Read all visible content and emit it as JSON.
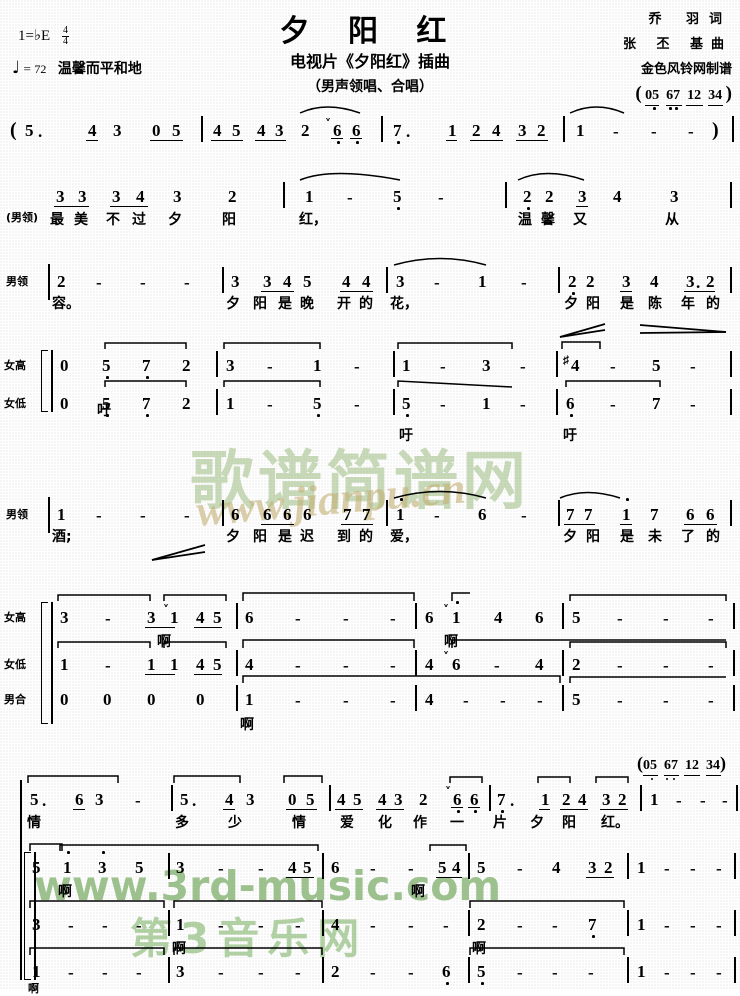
{
  "header": {
    "title": "夕 阳 红",
    "subtitle1": "电视片《夕阳红》插曲",
    "subtitle2": "（男声领唱、合唱）",
    "key_signature": "1=♭E",
    "time_signature": {
      "numerator": "4",
      "denominator": "4"
    },
    "tempo_note_glyph": "♩",
    "tempo_eq": "=",
    "tempo_bpm": "72",
    "expression": "温馨而平和地",
    "credits": {
      "lyricist": "乔  羽词",
      "composer": "张 丕 基曲",
      "transcriber": "金色风铃网制谱",
      "pickup": "( 05  67  12  34 )"
    }
  },
  "watermarks": {
    "green_cn": "歌谱简谱网",
    "tan_url": "www.jianpu.cn",
    "green_url": "www.3rd-music.com",
    "green_cn2": "第3音乐网",
    "green_color": "#96b878",
    "tan_color": "#c4b078",
    "bright_green_color": "#78aa64"
  },
  "part_labels": {
    "male_lead": "男领",
    "male_lead_paren": "(男领)",
    "soprano": "女高",
    "alto": "女低",
    "male_chorus": "男合"
  },
  "systems": [
    {
      "id": "intro",
      "label": "",
      "notes": "(5.   4 3  0 5 | 4 5 4 3 2 ˅6 6 | 7.   1 2 4 3 2 | 1 - - - )",
      "lyrics": ""
    },
    {
      "id": "verse1-a",
      "label": "(男领)",
      "notes": "3 3 3 4 3 2 | 1 - 5 - | 2 2 3 4 3",
      "lyrics": "最 美 不 过 夕 阳    红，        温 馨   又 从"
    },
    {
      "id": "verse1-b",
      "label": "男领",
      "notes": "2 - - - | 3 3 4 5 4 4 | 3 - 1 - | 2 2 3 4 3. 2",
      "lyrics": "容。      夕 阳 是 晚 开 的 花，      夕 阳 是 陈 年 的"
    },
    {
      "id": "verse1-sop",
      "label": "女高",
      "notes": "0 5 7 2 | 3 - 1 - | 1 - 3 - | ♯4 - 5 -",
      "lyrics": ""
    },
    {
      "id": "verse1-alto",
      "label": "女低",
      "notes": "0 5 7 2 | 1 - 5 - | 5 - 1 - | 6 - 7 -",
      "lyrics": "吁            吁      吁"
    },
    {
      "id": "verse2-lead",
      "label": "男领",
      "notes": "1 - - - | 6 6 6 6 7 7 | 1 - 6 - | 7 7 i 7 6 6",
      "lyrics": "酒;      夕 阳 是 迟 到 的 爱，      夕 阳 是 未 了 的"
    },
    {
      "id": "verse2-sop",
      "label": "女高",
      "notes": "3 - 3 ˅1 4 5 | 6 - - - 6 ˅i 4 6 | 5 - - -",
      "lyrics": "啊        啊"
    },
    {
      "id": "verse2-alto",
      "label": "女低",
      "notes": "1 - 1 1 4 5 | 4 - - - 4 ˅6 - 4 | 2 - - -",
      "lyrics": ""
    },
    {
      "id": "verse2-malechorus",
      "label": "男合",
      "notes": "0 0 0 0 | 1 - - - | 4 - - - | 5 - - -",
      "lyrics": "啊"
    },
    {
      "id": "final-lead",
      "label": "",
      "notes": "5. 6 3 - | 5. 4 3 0 5 | 4 5 4 3 2 ˅6 6 | 7. 1 2 4 3 2 | 1 - - -",
      "lyrics": "情      多  少   情   爱 化 作 一  片 夕 阳  红。",
      "pickup": "( 05  67  12  34 )"
    },
    {
      "id": "final-sop",
      "label": "",
      "notes": "5 i 3 5 | 3 - - 4 5 | 6 - - 5 4 | 5 - 4 3 2 | 1 - - -",
      "lyrics": "啊          啊"
    },
    {
      "id": "final-alto",
      "label": "",
      "notes": "3 - - - | 1 - - - 4 | - - - | 2 - - 7 | 1 - - -",
      "lyrics": "啊          啊"
    },
    {
      "id": "final-malechorus",
      "label": "",
      "notes": "1 - - - | 3 - - - 2 | - - 6 | 5 - - - | 1 - - -",
      "lyrics": "啊"
    }
  ],
  "dynamics": [
    {
      "type": "crescendo",
      "system": "verse1-lead"
    },
    {
      "type": "diminuendo",
      "system": "verse1-lead"
    },
    {
      "type": "crescendo",
      "system": "verse2-lead"
    }
  ]
}
